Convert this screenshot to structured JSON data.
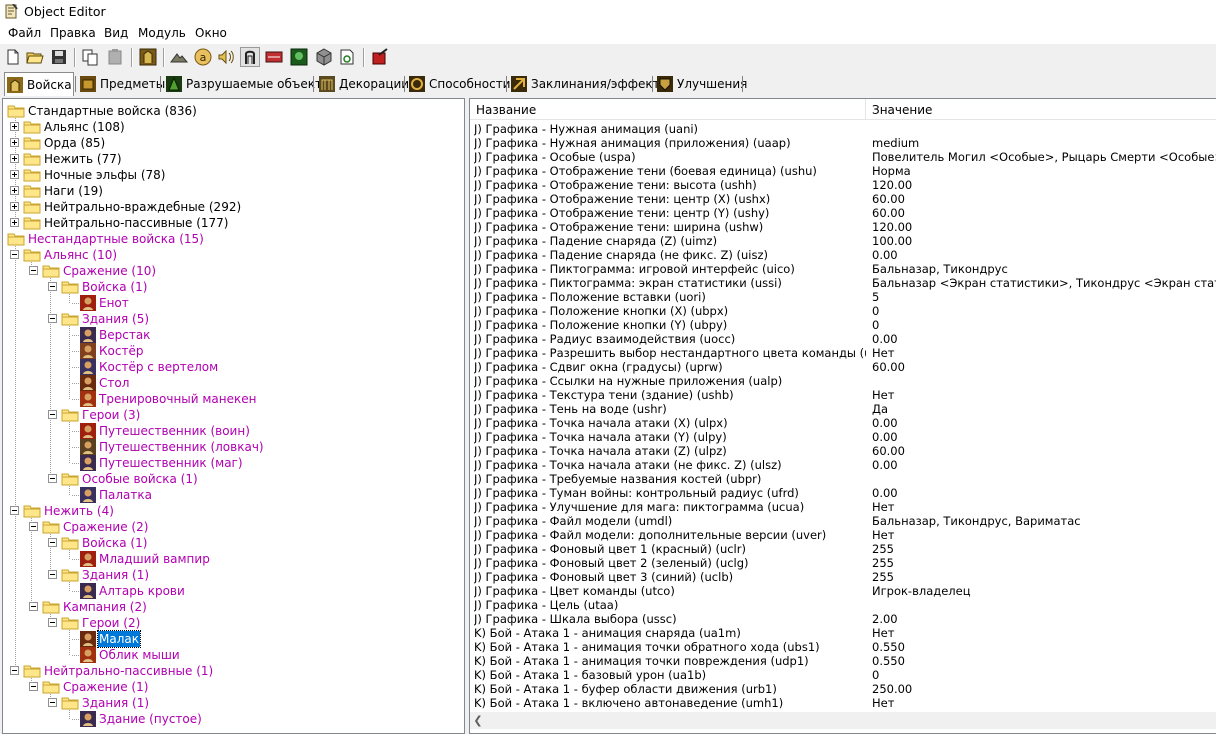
{
  "window": {
    "title": "Object Editor"
  },
  "menu": [
    "Файл",
    "Правка",
    "Вид",
    "Модуль",
    "Окно"
  ],
  "toolbar": {
    "buttons": [
      "new-icon",
      "open-icon",
      "save-icon",
      "copy-icon",
      "paste-icon",
      "unit-editor-icon",
      "terrain-icon",
      "text-icon",
      "sound-icon",
      "import-icon",
      "export-icon",
      "model-icon",
      "cube-icon",
      "settings-icon",
      "test-map-icon"
    ],
    "pressed_index": 10
  },
  "tabs": [
    {
      "label": "Войска",
      "icon": "tab-units-icon",
      "active": true
    },
    {
      "label": "Предметы",
      "icon": "tab-items-icon",
      "active": false
    },
    {
      "label": "Разрушаемые объекты",
      "icon": "tab-destructibles-icon",
      "active": false
    },
    {
      "label": "Декорации",
      "icon": "tab-doodads-icon",
      "active": false
    },
    {
      "label": "Способности",
      "icon": "tab-abilities-icon",
      "active": false
    },
    {
      "label": "Заклинания/эффекты",
      "icon": "tab-buffs-icon",
      "active": false
    },
    {
      "label": "Улучшения",
      "icon": "tab-upgrades-icon",
      "active": false
    }
  ],
  "tree": [
    {
      "label": "Стандартные войска (836)",
      "level": 0,
      "type": "folder",
      "exp": "open",
      "custom": false
    },
    {
      "label": "Альянс (108)",
      "level": 1,
      "type": "folder",
      "exp": "plus",
      "custom": false
    },
    {
      "label": "Орда (85)",
      "level": 1,
      "type": "folder",
      "exp": "plus",
      "custom": false
    },
    {
      "label": "Нежить (77)",
      "level": 1,
      "type": "folder",
      "exp": "plus",
      "custom": false
    },
    {
      "label": "Ночные эльфы (78)",
      "level": 1,
      "type": "folder",
      "exp": "plus",
      "custom": false
    },
    {
      "label": "Наги (19)",
      "level": 1,
      "type": "folder",
      "exp": "plus",
      "custom": false
    },
    {
      "label": "Нейтрально-враждебные (292)",
      "level": 1,
      "type": "folder",
      "exp": "plus",
      "custom": false
    },
    {
      "label": "Нейтрально-пассивные (177)",
      "level": 1,
      "type": "folder",
      "exp": "plus",
      "custom": false
    },
    {
      "label": "Нестандартные войска (15)",
      "level": 0,
      "type": "folder",
      "exp": "open",
      "custom": true
    },
    {
      "label": "Альянс (10)",
      "level": 1,
      "type": "folder",
      "exp": "minus",
      "custom": true
    },
    {
      "label": "Сражение (10)",
      "level": 2,
      "type": "folder",
      "exp": "minus",
      "custom": true
    },
    {
      "label": "Войска (1)",
      "level": 3,
      "type": "folder",
      "exp": "minus",
      "custom": true
    },
    {
      "label": "Енот",
      "level": 4,
      "type": "unit",
      "icon": "raccoon-icon",
      "custom": true
    },
    {
      "label": "Здания (5)",
      "level": 3,
      "type": "folder",
      "exp": "minus",
      "custom": true
    },
    {
      "label": "Верстак",
      "level": 4,
      "type": "unit",
      "icon": "workbench-icon",
      "custom": true
    },
    {
      "label": "Костёр",
      "level": 4,
      "type": "unit",
      "icon": "campfire-icon",
      "custom": true
    },
    {
      "label": "Костёр с вертелом",
      "level": 4,
      "type": "unit",
      "icon": "campfire-spit-icon",
      "custom": true
    },
    {
      "label": "Стол",
      "level": 4,
      "type": "unit",
      "icon": "table-icon",
      "custom": true
    },
    {
      "label": "Тренировочный манекен",
      "level": 4,
      "type": "unit",
      "icon": "dummy-icon",
      "custom": true
    },
    {
      "label": "Герои (3)",
      "level": 3,
      "type": "folder",
      "exp": "minus",
      "custom": true
    },
    {
      "label": "Путешественник (воин)",
      "level": 4,
      "type": "unit",
      "icon": "traveler-warrior-icon",
      "custom": true
    },
    {
      "label": "Путешественник (ловкач)",
      "level": 4,
      "type": "unit",
      "icon": "traveler-rogue-icon",
      "custom": true
    },
    {
      "label": "Путешественник (маг)",
      "level": 4,
      "type": "unit",
      "icon": "traveler-mage-icon",
      "custom": true
    },
    {
      "label": "Особые войска (1)",
      "level": 3,
      "type": "folder",
      "exp": "minus",
      "custom": true
    },
    {
      "label": "Палатка",
      "level": 4,
      "type": "unit",
      "icon": "tent-icon",
      "custom": true
    },
    {
      "label": "Нежить (4)",
      "level": 1,
      "type": "folder",
      "exp": "minus",
      "custom": true
    },
    {
      "label": "Сражение (2)",
      "level": 2,
      "type": "folder",
      "exp": "minus",
      "custom": true
    },
    {
      "label": "Войска (1)",
      "level": 3,
      "type": "folder",
      "exp": "minus",
      "custom": true
    },
    {
      "label": "Младший вампир",
      "level": 4,
      "type": "unit",
      "icon": "vampire-icon",
      "custom": true
    },
    {
      "label": "Здания (1)",
      "level": 3,
      "type": "folder",
      "exp": "minus",
      "custom": true
    },
    {
      "label": "Алтарь крови",
      "level": 4,
      "type": "unit",
      "icon": "blood-altar-icon",
      "custom": true
    },
    {
      "label": "Кампания (2)",
      "level": 2,
      "type": "folder",
      "exp": "minus",
      "custom": true
    },
    {
      "label": "Герои (2)",
      "level": 3,
      "type": "folder",
      "exp": "minus",
      "custom": true
    },
    {
      "label": "Малак",
      "level": 4,
      "type": "unit",
      "icon": "malak-icon",
      "custom": true,
      "selected": true
    },
    {
      "label": "Облик мыши",
      "level": 4,
      "type": "unit",
      "icon": "mouse-form-icon",
      "custom": true
    },
    {
      "label": "Нейтрально-пассивные (1)",
      "level": 1,
      "type": "folder",
      "exp": "minus",
      "custom": true
    },
    {
      "label": "Сражение (1)",
      "level": 2,
      "type": "folder",
      "exp": "minus",
      "custom": true
    },
    {
      "label": "Здания (1)",
      "level": 3,
      "type": "folder",
      "exp": "minus",
      "custom": true
    },
    {
      "label": "Здание (пустое)",
      "level": 4,
      "type": "unit",
      "icon": "empty-building-icon",
      "custom": true
    }
  ],
  "list": {
    "columns": [
      "Название",
      "Значение"
    ],
    "rows": [
      [
        "J) Графика - Нужная анимация (uani)",
        ""
      ],
      [
        "J) Графика - Нужная анимация (приложения) (uaap)",
        "medium"
      ],
      [
        "J) Графика - Особые (uspa)",
        "Повелитель Могил <Особые>, Рыцарь Смерти <Особые>, ..."
      ],
      [
        "J) Графика - Отображение тени (боевая единица) (ushu)",
        "Норма"
      ],
      [
        "J) Графика - Отображение тени: высота (ushh)",
        "120.00"
      ],
      [
        "J) Графика - Отображение тени: центр (X) (ushx)",
        "60.00"
      ],
      [
        "J) Графика - Отображение тени: центр (Y) (ushy)",
        "60.00"
      ],
      [
        "J) Графика - Отображение тени: ширина (ushw)",
        "120.00"
      ],
      [
        "J) Графика - Падение снаряда (Z) (uimz)",
        "100.00"
      ],
      [
        "J) Графика - Падение снаряда (не фикс. Z) (uisz)",
        "0.00"
      ],
      [
        "J) Графика - Пиктограмма: игровой интерфейс (uico)",
        "Бальназар, Тикондрус"
      ],
      [
        "J) Графика - Пиктограмма: экран статистики (ussi)",
        "Бальназар <Экран статистики>, Тикондрус <Экран статистики>"
      ],
      [
        "J) Графика - Положение вставки (uori)",
        "5"
      ],
      [
        "J) Графика - Положение кнопки (X) (ubpx)",
        "0"
      ],
      [
        "J) Графика - Положение кнопки (Y) (ubpy)",
        "0"
      ],
      [
        "J) Графика - Радиус взаимодействия (uocc)",
        "0.00"
      ],
      [
        "J) Графика - Разрешить выбор нестандартного цвета команды (utcc)",
        "Нет"
      ],
      [
        "J) Графика - Сдвиг окна (градусы) (uprw)",
        "60.00"
      ],
      [
        "J) Графика - Ссылки на нужные приложения (ualp)",
        ""
      ],
      [
        "J) Графика - Текстура тени (здание) (ushb)",
        "Нет"
      ],
      [
        "J) Графика - Тень на воде (ushr)",
        "Да"
      ],
      [
        "J) Графика - Точка начала атаки (X) (ulpx)",
        "0.00"
      ],
      [
        "J) Графика - Точка начала атаки (Y) (ulpy)",
        "0.00"
      ],
      [
        "J) Графика - Точка начала атаки (Z) (ulpz)",
        "60.00"
      ],
      [
        "J) Графика - Точка начала атаки (не фикс. Z) (ulsz)",
        "0.00"
      ],
      [
        "J) Графика - Требуемые названия костей (ubpr)",
        ""
      ],
      [
        "J) Графика - Туман войны: контрольный радиус (ufrd)",
        "0.00"
      ],
      [
        "J) Графика - Улучшение для мага: пиктограмма (ucua)",
        "Нет"
      ],
      [
        "J) Графика - Файл модели (umdl)",
        "Бальназар, Тикондрус, Вариматас"
      ],
      [
        "J) Графика - Файл модели: дополнительные версии (uver)",
        "Нет"
      ],
      [
        "J) Графика - Фоновый цвет 1 (красный) (uclr)",
        "255"
      ],
      [
        "J) Графика - Фоновый цвет 2 (зеленый) (uclg)",
        "255"
      ],
      [
        "J) Графика - Фоновый цвет 3 (синий) (uclb)",
        "255"
      ],
      [
        "J) Графика - Цвет команды (utco)",
        "Игрок-владелец"
      ],
      [
        "J) Графика - Цель (utaa)",
        ""
      ],
      [
        "J) Графика - Шкала выбора (ussc)",
        "2.00"
      ],
      [
        "K) Бой - Атака 1 - анимация снаряда (ua1m)",
        "Нет"
      ],
      [
        "K) Бой - Атака 1 - анимация точки обратного хода (ubs1)",
        "0.550"
      ],
      [
        "K) Бой - Атака 1 - анимация точки повреждения (udp1)",
        "0.550"
      ],
      [
        "K) Бой - Атака 1 - базовый урон (ua1b)",
        "0"
      ],
      [
        "K) Бой - Атака 1 - буфер области движения (urb1)",
        "250.00"
      ],
      [
        "K) Бой - Атака 1 - включено автонаведение (umh1)",
        "Нет"
      ]
    ]
  },
  "colors": {
    "custom_text": "#b000b0",
    "selection": "#0078d7",
    "folder_fill": "#ffe68a",
    "folder_stroke": "#c8a42c"
  }
}
